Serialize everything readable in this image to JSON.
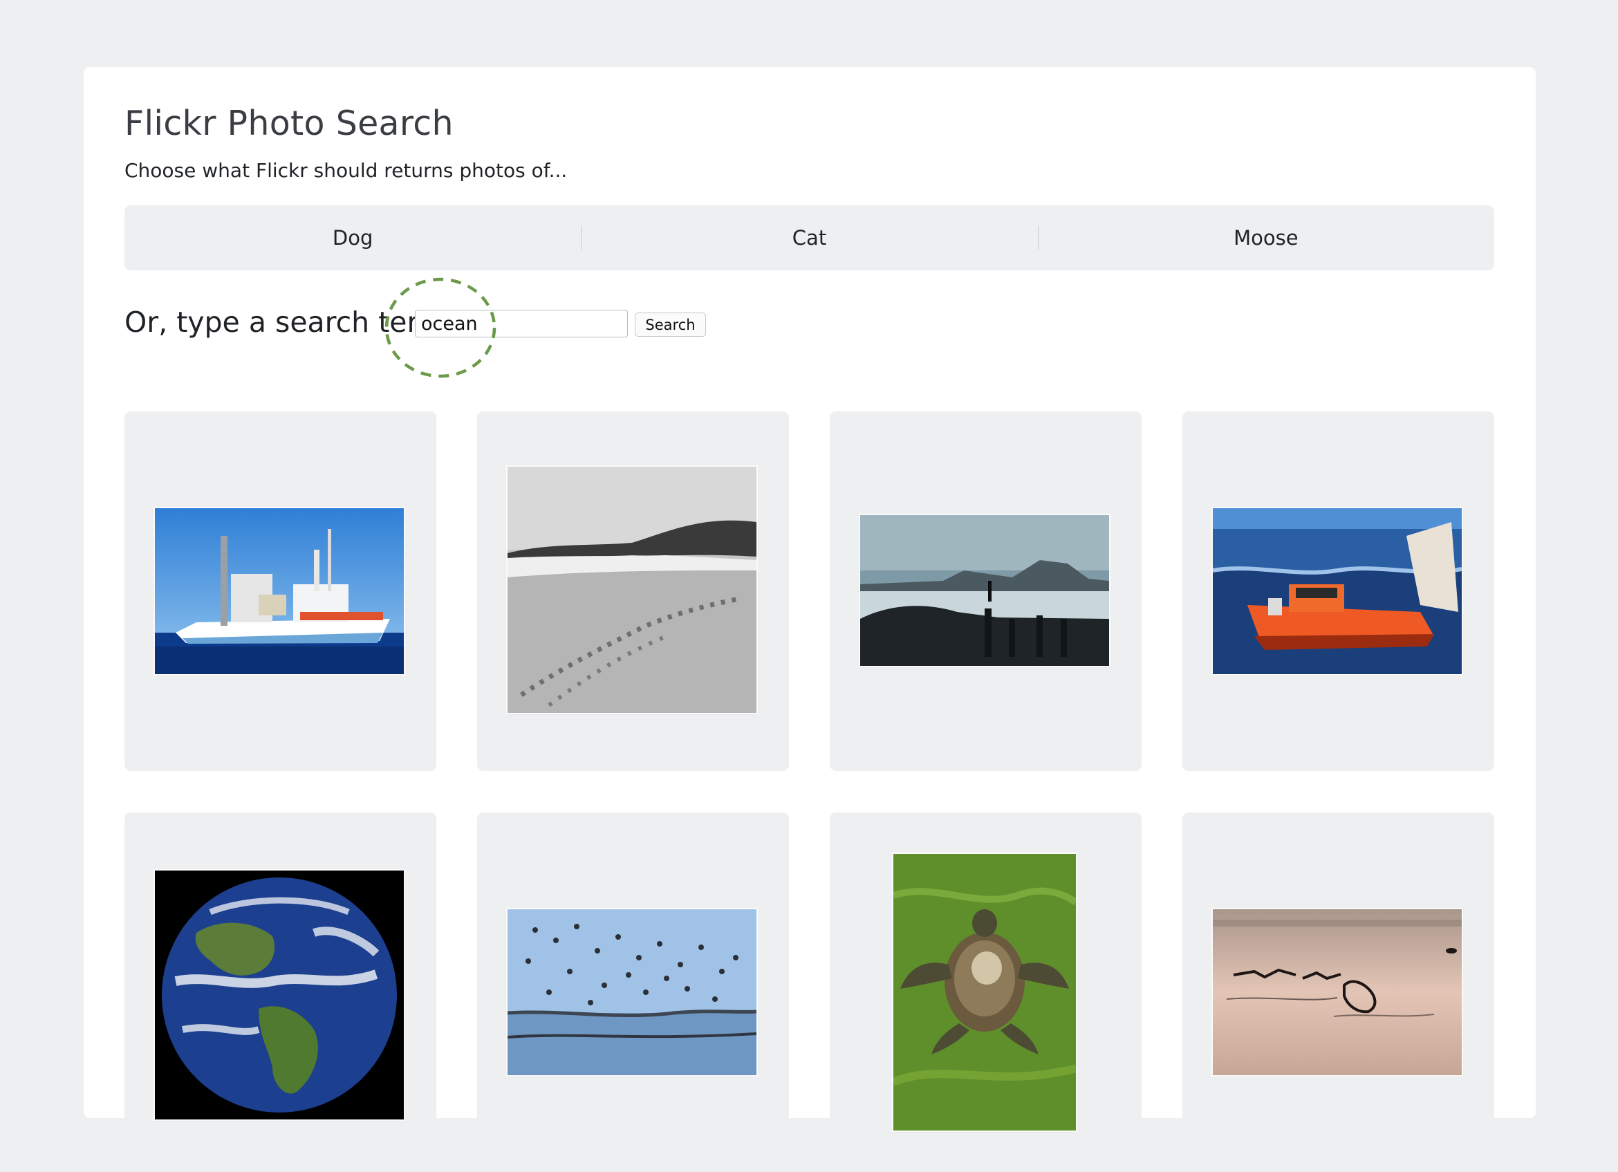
{
  "header": {
    "title": "Flickr Photo Search",
    "subtitle": "Choose what Flickr should returns photos of..."
  },
  "tabs": [
    {
      "label": "Dog"
    },
    {
      "label": "Cat"
    },
    {
      "label": "Moose"
    }
  ],
  "search": {
    "label": "Or, type a search term",
    "value": "ocean",
    "button_label": "Search"
  },
  "results": [
    {
      "subject": "research vessel at sea"
    },
    {
      "subject": "black and white beach with footprints"
    },
    {
      "subject": "shipwreck silhouette on shore"
    },
    {
      "subject": "orange rescue boat"
    },
    {
      "subject": "planet earth from space"
    },
    {
      "subject": "flock of shorebirds over water"
    },
    {
      "subject": "sea turtle in green water"
    },
    {
      "subject": "birds skimming pink water"
    }
  ],
  "colors": {
    "page_background": "#eeeff1",
    "card_background": "#ffffff",
    "click_marker": "#6b9a4a"
  }
}
